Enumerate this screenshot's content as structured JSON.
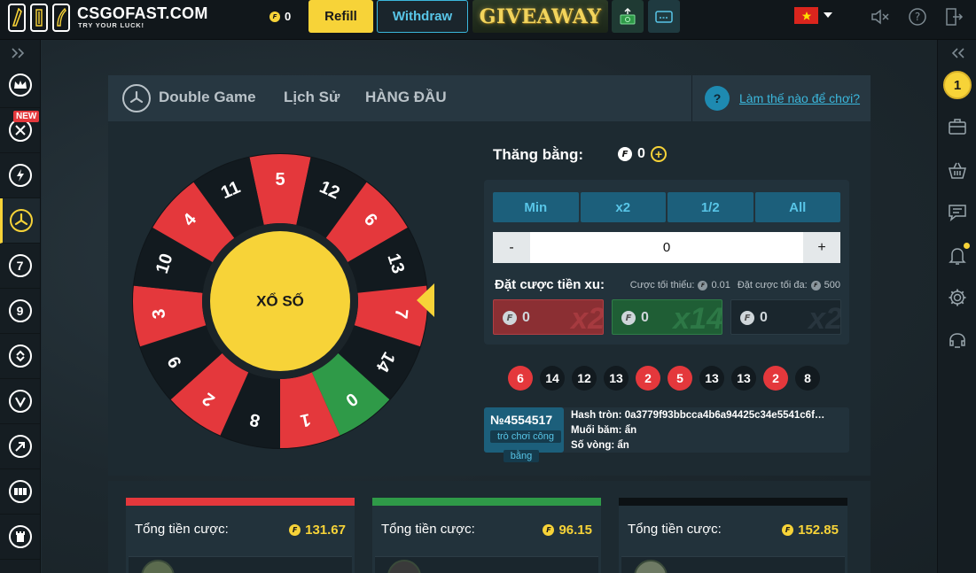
{
  "header": {
    "logo_title": "CSGOFAST.COM",
    "logo_tagline": "TRY YOUR LUCK!",
    "balance": "0",
    "refill_label": "Refill",
    "withdraw_label": "Withdraw",
    "giveaway_label": "GIVEAWAY",
    "coin_symbol": "F"
  },
  "left_sidebar": {
    "new_badge": "NEW",
    "items": [
      {
        "icon": "crown-icon"
      },
      {
        "icon": "crossed-swords-icon"
      },
      {
        "icon": "lightning-icon"
      },
      {
        "icon": "fan-wheel-icon",
        "active": true
      },
      {
        "icon": "seven-icon",
        "label": "7"
      },
      {
        "icon": "nine-icon",
        "label": "9"
      },
      {
        "icon": "updown-arrows-icon"
      },
      {
        "icon": "v-icon"
      },
      {
        "icon": "arrow-up-right-icon"
      },
      {
        "icon": "dots-icon"
      },
      {
        "icon": "tower-icon"
      }
    ]
  },
  "right_sidebar": {
    "level": "1"
  },
  "game": {
    "tabs": [
      "Double Game",
      "Lịch Sử",
      "HÀNG ĐẦU"
    ],
    "help_symbol": "?",
    "help_link": "Làm thế nào để chơi?",
    "wheel_center_label": "XỔ SỐ",
    "wheel_numbers": [
      "5",
      "12",
      "6",
      "13",
      "7",
      "14",
      "0",
      "1",
      "8",
      "2",
      "9",
      "3",
      "10",
      "4",
      "11"
    ],
    "wheel_colors": [
      "red",
      "black",
      "red",
      "black",
      "red",
      "black",
      "green",
      "red",
      "black",
      "red",
      "black",
      "red",
      "black",
      "red",
      "black"
    ],
    "colors": {
      "red": "#e4383c",
      "black": "#121a1f",
      "green": "#2f9a48",
      "yellow": "#f7d338",
      "accent": "#1c5f7b"
    }
  },
  "betting": {
    "balance_label": "Thăng bằng:",
    "balance_value": "0",
    "plus_symbol": "+",
    "quick_buttons": [
      "Min",
      "x2",
      "1/2",
      "All"
    ],
    "minus_label": "-",
    "plus_label": "+",
    "amount_value": "0",
    "bet_label": "Đặt cược tiền xu:",
    "min_bet_label": "Cược tối thiểu:",
    "min_bet_value": "0.01",
    "max_bet_label": "Đặt cược tối đa:",
    "max_bet_value": "500",
    "place_buttons": [
      {
        "amount": "0",
        "multiplier": "x2"
      },
      {
        "amount": "0",
        "multiplier": "x14"
      },
      {
        "amount": "0",
        "multiplier": "x2"
      }
    ]
  },
  "history": [
    {
      "number": "6",
      "color": "red"
    },
    {
      "number": "14",
      "color": "black"
    },
    {
      "number": "12",
      "color": "black"
    },
    {
      "number": "13",
      "color": "black"
    },
    {
      "number": "2",
      "color": "red"
    },
    {
      "number": "5",
      "color": "red"
    },
    {
      "number": "13",
      "color": "black"
    },
    {
      "number": "13",
      "color": "black"
    },
    {
      "number": "2",
      "color": "red"
    },
    {
      "number": "8",
      "color": "black"
    }
  ],
  "fair": {
    "round_id": "№4554517",
    "tag_line1": "trò chơi công",
    "tag_line2": "bằng",
    "hash": "Hash tròn: 0a3779f93bbcca4b6a94425c34e5541c6f…",
    "salt": "Muối băm: ẩn",
    "round": "Số vòng: ẩn"
  },
  "totals": [
    {
      "label": "Tổng tiền cược:",
      "value": "131.67",
      "color": "red"
    },
    {
      "label": "Tổng tiền cược:",
      "value": "96.15",
      "color": "green"
    },
    {
      "label": "Tổng tiền cược:",
      "value": "152.85",
      "color": "black"
    }
  ]
}
